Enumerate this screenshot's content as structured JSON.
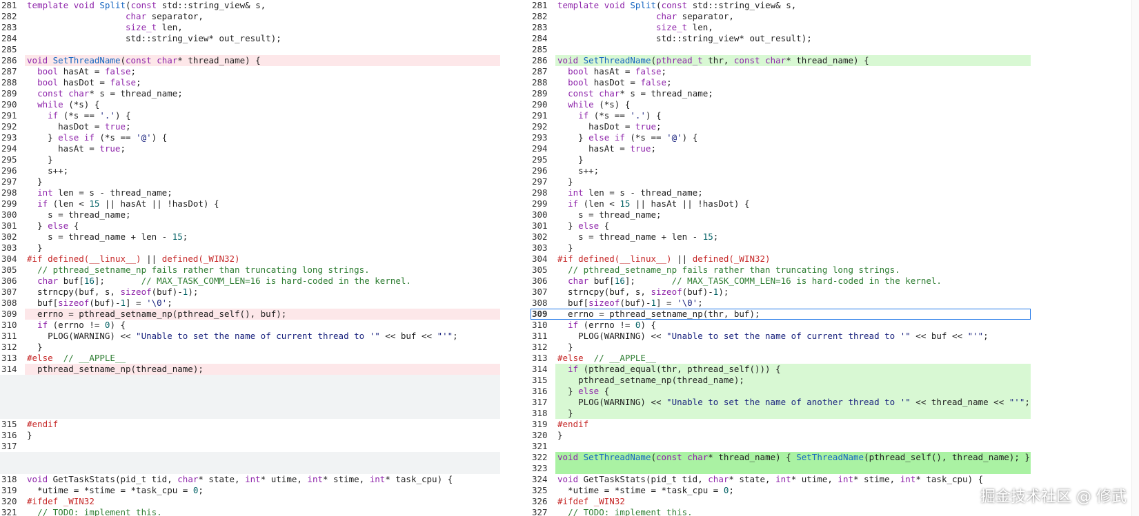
{
  "watermark": "掘金技术社区 @ 修武",
  "left": [
    {
      "num": "281",
      "text": "template void Split(const std::string_view& s,",
      "type": "normal"
    },
    {
      "num": "282",
      "text": "                   char separator,",
      "type": "normal"
    },
    {
      "num": "283",
      "text": "                   size_t len,",
      "type": "normal"
    },
    {
      "num": "284",
      "text": "                   std::string_view* out_result);",
      "type": "normal"
    },
    {
      "num": "285",
      "text": "",
      "type": "normal"
    },
    {
      "num": "286",
      "text": "void SetThreadName(const char* thread_name) {",
      "type": "removed"
    },
    {
      "num": "287",
      "text": "  bool hasAt = false;",
      "type": "normal"
    },
    {
      "num": "288",
      "text": "  bool hasDot = false;",
      "type": "normal"
    },
    {
      "num": "289",
      "text": "  const char* s = thread_name;",
      "type": "normal"
    },
    {
      "num": "290",
      "text": "  while (*s) {",
      "type": "normal"
    },
    {
      "num": "291",
      "text": "    if (*s == '.') {",
      "type": "normal"
    },
    {
      "num": "292",
      "text": "      hasDot = true;",
      "type": "normal"
    },
    {
      "num": "293",
      "text": "    } else if (*s == '@') {",
      "type": "normal"
    },
    {
      "num": "294",
      "text": "      hasAt = true;",
      "type": "normal"
    },
    {
      "num": "295",
      "text": "    }",
      "type": "normal"
    },
    {
      "num": "296",
      "text": "    s++;",
      "type": "normal"
    },
    {
      "num": "297",
      "text": "  }",
      "type": "normal"
    },
    {
      "num": "298",
      "text": "  int len = s - thread_name;",
      "type": "normal"
    },
    {
      "num": "299",
      "text": "  if (len < 15 || hasAt || !hasDot) {",
      "type": "normal"
    },
    {
      "num": "300",
      "text": "    s = thread_name;",
      "type": "normal"
    },
    {
      "num": "301",
      "text": "  } else {",
      "type": "normal"
    },
    {
      "num": "302",
      "text": "    s = thread_name + len - 15;",
      "type": "normal"
    },
    {
      "num": "303",
      "text": "  }",
      "type": "normal"
    },
    {
      "num": "304",
      "text": "#if defined(__linux__) || defined(_WIN32)",
      "type": "normal"
    },
    {
      "num": "305",
      "text": "  // pthread_setname_np fails rather than truncating long strings.",
      "type": "normal"
    },
    {
      "num": "306",
      "text": "  char buf[16];       // MAX_TASK_COMM_LEN=16 is hard-coded in the kernel.",
      "type": "normal"
    },
    {
      "num": "307",
      "text": "  strncpy(buf, s, sizeof(buf)-1);",
      "type": "normal"
    },
    {
      "num": "308",
      "text": "  buf[sizeof(buf)-1] = '\\0';",
      "type": "normal"
    },
    {
      "num": "309",
      "text": "  errno = pthread_setname_np(pthread_self(), buf);",
      "type": "removed"
    },
    {
      "num": "310",
      "text": "  if (errno != 0) {",
      "type": "normal"
    },
    {
      "num": "311",
      "text": "    PLOG(WARNING) << \"Unable to set the name of current thread to '\" << buf << \"'\";",
      "type": "normal"
    },
    {
      "num": "312",
      "text": "  }",
      "type": "normal"
    },
    {
      "num": "313",
      "text": "#else  // __APPLE__",
      "type": "normal"
    },
    {
      "num": "314",
      "text": "  pthread_setname_np(thread_name);",
      "type": "removed"
    },
    {
      "num": "",
      "text": "",
      "type": "blank"
    },
    {
      "num": "",
      "text": "",
      "type": "blank"
    },
    {
      "num": "",
      "text": "",
      "type": "blank"
    },
    {
      "num": "",
      "text": "",
      "type": "blank"
    },
    {
      "num": "315",
      "text": "#endif",
      "type": "normal"
    },
    {
      "num": "316",
      "text": "}",
      "type": "normal"
    },
    {
      "num": "317",
      "text": "",
      "type": "normal"
    },
    {
      "num": "",
      "text": "",
      "type": "blank"
    },
    {
      "num": "",
      "text": "",
      "type": "blank"
    },
    {
      "num": "318",
      "text": "void GetTaskStats(pid_t tid, char* state, int* utime, int* stime, int* task_cpu) {",
      "type": "normal"
    },
    {
      "num": "319",
      "text": "  *utime = *stime = *task_cpu = 0;",
      "type": "normal"
    },
    {
      "num": "320",
      "text": "#ifdef _WIN32",
      "type": "normal"
    },
    {
      "num": "321",
      "text": "  // TODO: implement this.",
      "type": "normal"
    }
  ],
  "right": [
    {
      "num": "281",
      "text": "template void Split(const std::string_view& s,",
      "type": "normal"
    },
    {
      "num": "282",
      "text": "                   char separator,",
      "type": "normal"
    },
    {
      "num": "283",
      "text": "                   size_t len,",
      "type": "normal"
    },
    {
      "num": "284",
      "text": "                   std::string_view* out_result);",
      "type": "normal"
    },
    {
      "num": "285",
      "text": "",
      "type": "normal"
    },
    {
      "num": "286",
      "text": "void SetThreadName(pthread_t thr, const char* thread_name) {",
      "type": "added"
    },
    {
      "num": "287",
      "text": "  bool hasAt = false;",
      "type": "normal"
    },
    {
      "num": "288",
      "text": "  bool hasDot = false;",
      "type": "normal"
    },
    {
      "num": "289",
      "text": "  const char* s = thread_name;",
      "type": "normal"
    },
    {
      "num": "290",
      "text": "  while (*s) {",
      "type": "normal"
    },
    {
      "num": "291",
      "text": "    if (*s == '.') {",
      "type": "normal"
    },
    {
      "num": "292",
      "text": "      hasDot = true;",
      "type": "normal"
    },
    {
      "num": "293",
      "text": "    } else if (*s == '@') {",
      "type": "normal"
    },
    {
      "num": "294",
      "text": "      hasAt = true;",
      "type": "normal"
    },
    {
      "num": "295",
      "text": "    }",
      "type": "normal"
    },
    {
      "num": "296",
      "text": "    s++;",
      "type": "normal"
    },
    {
      "num": "297",
      "text": "  }",
      "type": "normal"
    },
    {
      "num": "298",
      "text": "  int len = s - thread_name;",
      "type": "normal"
    },
    {
      "num": "299",
      "text": "  if (len < 15 || hasAt || !hasDot) {",
      "type": "normal"
    },
    {
      "num": "300",
      "text": "    s = thread_name;",
      "type": "normal"
    },
    {
      "num": "301",
      "text": "  } else {",
      "type": "normal"
    },
    {
      "num": "302",
      "text": "    s = thread_name + len - 15;",
      "type": "normal"
    },
    {
      "num": "303",
      "text": "  }",
      "type": "normal"
    },
    {
      "num": "304",
      "text": "#if defined(__linux__) || defined(_WIN32)",
      "type": "normal"
    },
    {
      "num": "305",
      "text": "  // pthread_setname_np fails rather than truncating long strings.",
      "type": "normal"
    },
    {
      "num": "306",
      "text": "  char buf[16];       // MAX_TASK_COMM_LEN=16 is hard-coded in the kernel.",
      "type": "normal"
    },
    {
      "num": "307",
      "text": "  strncpy(buf, s, sizeof(buf)-1);",
      "type": "normal"
    },
    {
      "num": "308",
      "text": "  buf[sizeof(buf)-1] = '\\0';",
      "type": "normal"
    },
    {
      "num": "309",
      "text": "  errno = pthread_setname_np(thr, buf);",
      "type": "current"
    },
    {
      "num": "310",
      "text": "  if (errno != 0) {",
      "type": "normal"
    },
    {
      "num": "311",
      "text": "    PLOG(WARNING) << \"Unable to set the name of current thread to '\" << buf << \"'\";",
      "type": "normal"
    },
    {
      "num": "312",
      "text": "  }",
      "type": "normal"
    },
    {
      "num": "313",
      "text": "#else  // __APPLE__",
      "type": "normal"
    },
    {
      "num": "314",
      "text": "  if (pthread_equal(thr, pthread_self())) {",
      "type": "added"
    },
    {
      "num": "315",
      "text": "    pthread_setname_np(thread_name);",
      "type": "added"
    },
    {
      "num": "316",
      "text": "  } else {",
      "type": "added"
    },
    {
      "num": "317",
      "text": "    PLOG(WARNING) << \"Unable to set the name of another thread to '\" << thread_name << \"'\";",
      "type": "added"
    },
    {
      "num": "318",
      "text": "  }",
      "type": "added"
    },
    {
      "num": "319",
      "text": "#endif",
      "type": "normal"
    },
    {
      "num": "320",
      "text": "}",
      "type": "normal"
    },
    {
      "num": "321",
      "text": "",
      "type": "normal"
    },
    {
      "num": "322",
      "text": "void SetThreadName(const char* thread_name) { SetThreadName(pthread_self(), thread_name); }",
      "type": "added-strong"
    },
    {
      "num": "323",
      "text": "",
      "type": "added-strong"
    },
    {
      "num": "324",
      "text": "void GetTaskStats(pid_t tid, char* state, int* utime, int* stime, int* task_cpu) {",
      "type": "normal"
    },
    {
      "num": "325",
      "text": "  *utime = *stime = *task_cpu = 0;",
      "type": "normal"
    },
    {
      "num": "326",
      "text": "#ifdef _WIN32",
      "type": "normal"
    },
    {
      "num": "327",
      "text": "  // TODO: implement this.",
      "type": "normal"
    }
  ]
}
